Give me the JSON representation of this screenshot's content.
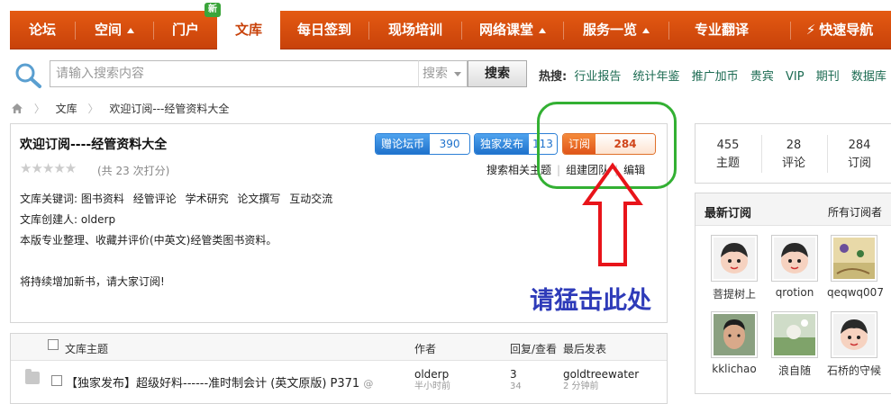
{
  "nav": {
    "items": [
      "论坛",
      "空间",
      "门户",
      "文库",
      "每日签到",
      "现场培训",
      "网络课堂",
      "服务一览",
      "专业翻译",
      "快速导航"
    ],
    "new_badge": "新"
  },
  "search": {
    "placeholder": "请输入搜索内容",
    "select_value": "搜索",
    "button": "搜索",
    "hot_label": "热搜:",
    "hot_links": [
      "行业报告",
      "统计年鉴",
      "推广加币",
      "贵宾",
      "VIP",
      "期刊",
      "数据库"
    ]
  },
  "breadcrumb": [
    "文库",
    "欢迎订阅---经管资料大全"
  ],
  "info": {
    "title": "欢迎订阅----经管资料大全",
    "stars": "★★★★★",
    "rating": "(共 23 次打分)",
    "keywords_label": "文库关键词:",
    "keywords": [
      "图书资料",
      "经管评论",
      "学术研究",
      "论文撰写",
      "互动交流"
    ],
    "creator_label": "文库创建人:",
    "creator": "olderp",
    "desc": "本版专业整理、收藏并评价(中英文)经管类图书资料。",
    "note": "将持续增加新书，请大家订阅!",
    "pills": [
      {
        "label": "赠论坛币",
        "value": "390"
      },
      {
        "label": "独家发布",
        "value": "113"
      },
      {
        "label": "订阅",
        "value": "284"
      }
    ],
    "actions": [
      "搜索相关主题",
      "组建团队",
      "编辑"
    ]
  },
  "callout": {
    "text": "请猛击此处",
    "arrow_color": "#e8141a",
    "ellipse_color": "#33b033"
  },
  "threads": {
    "headers": {
      "title": "文库主题",
      "author": "作者",
      "replies": "回复/查看",
      "last": "最后发表"
    },
    "rows": [
      {
        "title": "【独家发布】超级好料------准时制会计 (英文原版) P371",
        "author": "olderp",
        "author_time": "半小时前",
        "replies": "3",
        "views": "34",
        "last_user": "goldtreewater",
        "last_time": "2 分钟前"
      }
    ]
  },
  "stats": [
    {
      "value": "455",
      "label": "主题"
    },
    {
      "value": "28",
      "label": "评论"
    },
    {
      "value": "284",
      "label": "订阅"
    }
  ],
  "subscribers": {
    "title": "最新订阅",
    "all": "所有订阅者",
    "users": [
      "菩提树上",
      "qrotion",
      "qeqwq007",
      "kklichao",
      "浪自随",
      "石桥的守候"
    ]
  },
  "colors": {
    "nav_orange": "#d44c0e",
    "link_green": "#1c6b52",
    "pill_blue": "#1f72cc",
    "pill_orange": "#e0551a",
    "caption_blue": "#2e3bb9"
  }
}
